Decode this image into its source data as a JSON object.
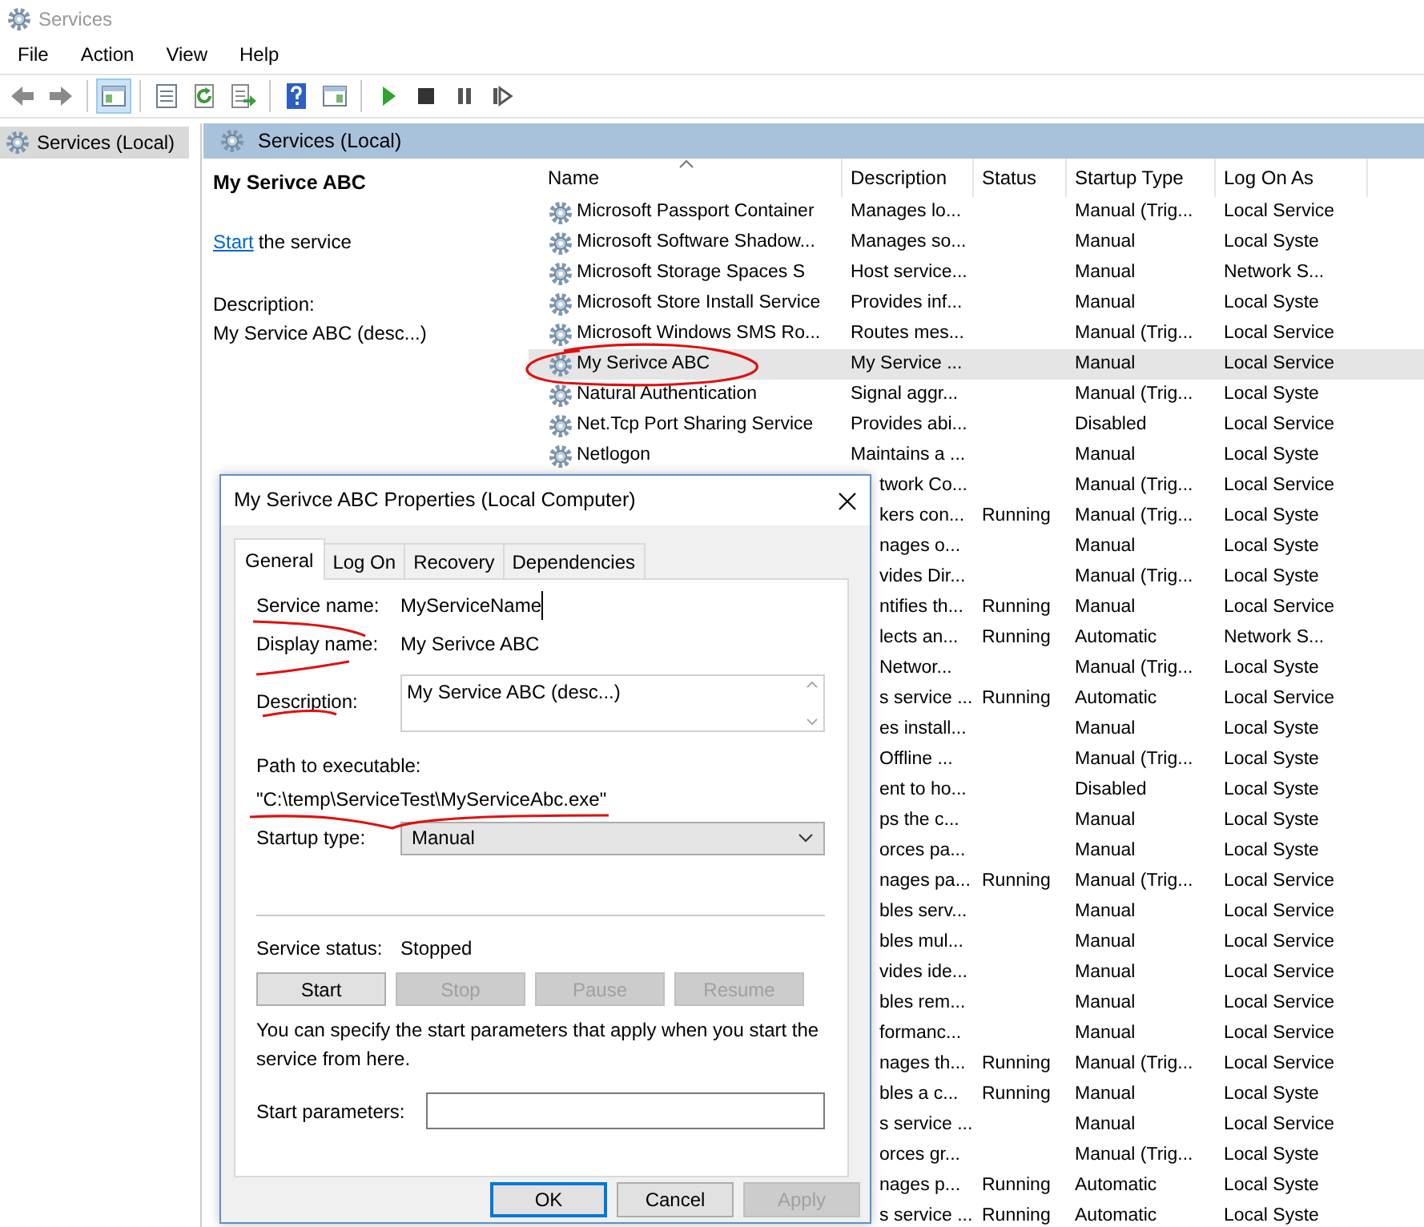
{
  "window": {
    "title": "Services"
  },
  "menu": [
    {
      "label": "File"
    },
    {
      "label": "Action"
    },
    {
      "label": "View"
    },
    {
      "label": "Help"
    }
  ],
  "toolbar": [
    {
      "kind": "back",
      "pressed": false
    },
    {
      "kind": "forward",
      "pressed": false
    },
    {
      "kind": "separator"
    },
    {
      "kind": "tree",
      "pressed": true
    },
    {
      "kind": "separator"
    },
    {
      "kind": "list",
      "pressed": false
    },
    {
      "kind": "refresh",
      "pressed": false
    },
    {
      "kind": "export",
      "pressed": false
    },
    {
      "kind": "separator"
    },
    {
      "kind": "help",
      "pressed": false
    },
    {
      "kind": "pane",
      "pressed": false
    },
    {
      "kind": "separator"
    },
    {
      "kind": "play",
      "pressed": false
    },
    {
      "kind": "stop",
      "pressed": false
    },
    {
      "kind": "pause",
      "pressed": false
    },
    {
      "kind": "restart",
      "pressed": false
    }
  ],
  "tree": [
    {
      "label": "Services (Local)",
      "selected": true
    }
  ],
  "panel": {
    "title": "Services (Local)",
    "service_name": "My Serivce ABC",
    "action_link": "Start",
    "action_text": "the service",
    "description_label": "Description:",
    "description": "My Service ABC (desc...)"
  },
  "columns": [
    {
      "label": "Name",
      "sorted": true
    },
    {
      "label": "Description",
      "sorted": false
    },
    {
      "label": "Status",
      "sorted": false
    },
    {
      "label": "Startup Type",
      "sorted": false
    },
    {
      "label": "Log On As",
      "sorted": false
    }
  ],
  "rows": [
    {
      "name": "Microsoft Passport Container",
      "description": "Manages lo...",
      "startup_type": "Manual (Trig...",
      "log_on_as": "Local Service",
      "selected": false
    },
    {
      "name": "Microsoft Software Shadow...",
      "description": "Manages so...",
      "startup_type": "Manual",
      "log_on_as": "Local Syste",
      "selected": false
    },
    {
      "name": "Microsoft Storage Spaces S",
      "description": "Host service...",
      "startup_type": "Manual",
      "log_on_as": "Network S...",
      "selected": false
    },
    {
      "name": "Microsoft Store Install Service",
      "description": "Provides inf...",
      "startup_type": "Manual",
      "log_on_as": "Local Syste",
      "selected": false
    },
    {
      "name": "Microsoft Windows SMS Ro...",
      "description": "Routes mes...",
      "startup_type": "Manual (Trig...",
      "log_on_as": "Local Service",
      "selected": false
    },
    {
      "name": "My Serivce ABC",
      "description": "My Service ...",
      "startup_type": "Manual",
      "log_on_as": "Local Service",
      "selected": true
    },
    {
      "name": "Natural Authentication",
      "description": "Signal aggr...",
      "startup_type": "Manual (Trig...",
      "log_on_as": "Local Syste",
      "selected": false
    },
    {
      "name": "Net.Tcp Port Sharing Service",
      "description": "Provides abi...",
      "startup_type": "Disabled",
      "log_on_as": "Local Service",
      "selected": false
    },
    {
      "name": "Netlogon",
      "description": "Maintains a ...",
      "startup_type": "Manual",
      "log_on_as": "Local Syste",
      "selected": false
    },
    {
      "description": "twork Co...",
      "startup_type": "Manual (Trig...",
      "log_on_as": "Local Service",
      "selected": false
    },
    {
      "description": "kers con...",
      "status": "Running",
      "startup_type": "Manual (Trig...",
      "log_on_as": "Local Syste",
      "selected": false
    },
    {
      "description": "nages o...",
      "startup_type": "Manual",
      "log_on_as": "Local Syste",
      "selected": false
    },
    {
      "description": "vides Dir...",
      "startup_type": "Manual (Trig...",
      "log_on_as": "Local Syste",
      "selected": false
    },
    {
      "description": "ntifies th...",
      "status": "Running",
      "startup_type": "Manual",
      "log_on_as": "Local Service",
      "selected": false
    },
    {
      "description": "lects an...",
      "status": "Running",
      "startup_type": "Automatic",
      "log_on_as": "Network S...",
      "selected": false
    },
    {
      "description": "Networ...",
      "startup_type": "Manual (Trig...",
      "log_on_as": "Local Syste",
      "selected": false
    },
    {
      "description": "s service ...",
      "status": "Running",
      "startup_type": "Automatic",
      "log_on_as": "Local Service",
      "selected": false
    },
    {
      "description": "es install...",
      "startup_type": "Manual",
      "log_on_as": "Local Syste",
      "selected": false
    },
    {
      "description": "Offline ...",
      "startup_type": "Manual (Trig...",
      "log_on_as": "Local Syste",
      "selected": false
    },
    {
      "description": "ent to ho...",
      "startup_type": "Disabled",
      "log_on_as": "Local Syste",
      "selected": false
    },
    {
      "description": "ps the c...",
      "startup_type": "Manual",
      "log_on_as": "Local Syste",
      "selected": false
    },
    {
      "description": "orces pa...",
      "startup_type": "Manual",
      "log_on_as": "Local Syste",
      "selected": false
    },
    {
      "description": "nages pa...",
      "status": "Running",
      "startup_type": "Manual (Trig...",
      "log_on_as": "Local Service",
      "selected": false
    },
    {
      "description": "bles serv...",
      "startup_type": "Manual",
      "log_on_as": "Local Service",
      "selected": false
    },
    {
      "description": "bles mul...",
      "startup_type": "Manual",
      "log_on_as": "Local Service",
      "selected": false
    },
    {
      "description": "vides ide...",
      "startup_type": "Manual",
      "log_on_as": "Local Service",
      "selected": false
    },
    {
      "description": "bles rem...",
      "startup_type": "Manual",
      "log_on_as": "Local Service",
      "selected": false
    },
    {
      "description": "formanc...",
      "startup_type": "Manual",
      "log_on_as": "Local Service",
      "selected": false
    },
    {
      "description": "nages th...",
      "status": "Running",
      "startup_type": "Manual (Trig...",
      "log_on_as": "Local Service",
      "selected": false
    },
    {
      "description": "bles a c...",
      "status": "Running",
      "startup_type": "Manual",
      "log_on_as": "Local Syste",
      "selected": false
    },
    {
      "description": "s service ...",
      "startup_type": "Manual",
      "log_on_as": "Local Service",
      "selected": false
    },
    {
      "description": "orces gr...",
      "startup_type": "Manual (Trig...",
      "log_on_as": "Local Syste",
      "selected": false
    },
    {
      "description": "nages p...",
      "status": "Running",
      "startup_type": "Automatic",
      "log_on_as": "Local Syste",
      "selected": false
    },
    {
      "description": "s service ...",
      "status": "Running",
      "startup_type": "Automatic",
      "log_on_as": "Local Syste",
      "selected": false
    }
  ],
  "dialog": {
    "title": "My Serivce ABC Properties (Local Computer)",
    "tabs": [
      {
        "label": "General",
        "selected": true
      },
      {
        "label": "Log On",
        "selected": false
      },
      {
        "label": "Recovery",
        "selected": false
      },
      {
        "label": "Dependencies",
        "selected": false
      }
    ],
    "fields": [
      {
        "kind": "text",
        "label": "Service name:",
        "value": "MyServiceName"
      },
      {
        "kind": "text",
        "label": "Display name:",
        "value": "My Serivce ABC"
      },
      {
        "kind": "textarea",
        "label": "Description:",
        "value": "My Service ABC (desc...)"
      }
    ],
    "path_label": "Path to executable:",
    "path": "\"C:\\temp\\ServiceTest\\MyServiceAbc.exe\"",
    "startup_label": "Startup type:",
    "startup_value": "Manual",
    "status_label": "Service status:",
    "status_value": "Stopped",
    "service_buttons": [
      {
        "label": "Start",
        "disabled": false
      },
      {
        "label": "Stop",
        "disabled": true
      },
      {
        "label": "Pause",
        "disabled": true
      },
      {
        "label": "Resume",
        "disabled": true
      }
    ],
    "hint": "You can specify the start parameters that apply when you start the service from here.",
    "params_label": "Start parameters:",
    "buttons": [
      {
        "label": "OK",
        "default": true,
        "disabled": false
      },
      {
        "label": "Cancel",
        "default": false,
        "disabled": false
      },
      {
        "label": "Apply",
        "default": false,
        "disabled": true
      }
    ]
  }
}
